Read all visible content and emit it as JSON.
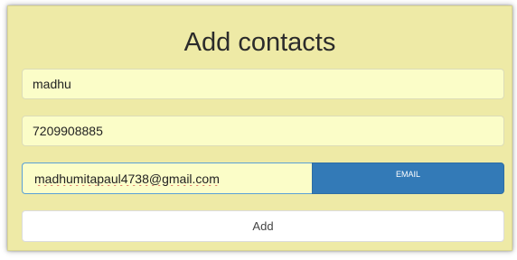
{
  "form": {
    "title": "Add contacts",
    "name_value": "madhu",
    "phone_value": "7209908885",
    "email_value": "madhumitapaul4738@gmail.com",
    "email_addon_label": "EMAIL",
    "add_button_label": "Add"
  },
  "colors": {
    "panel_background": "#eeeaa6",
    "input_background": "#fbfdc8",
    "addon_blue": "#337ab7",
    "button_background": "#ffffff"
  }
}
